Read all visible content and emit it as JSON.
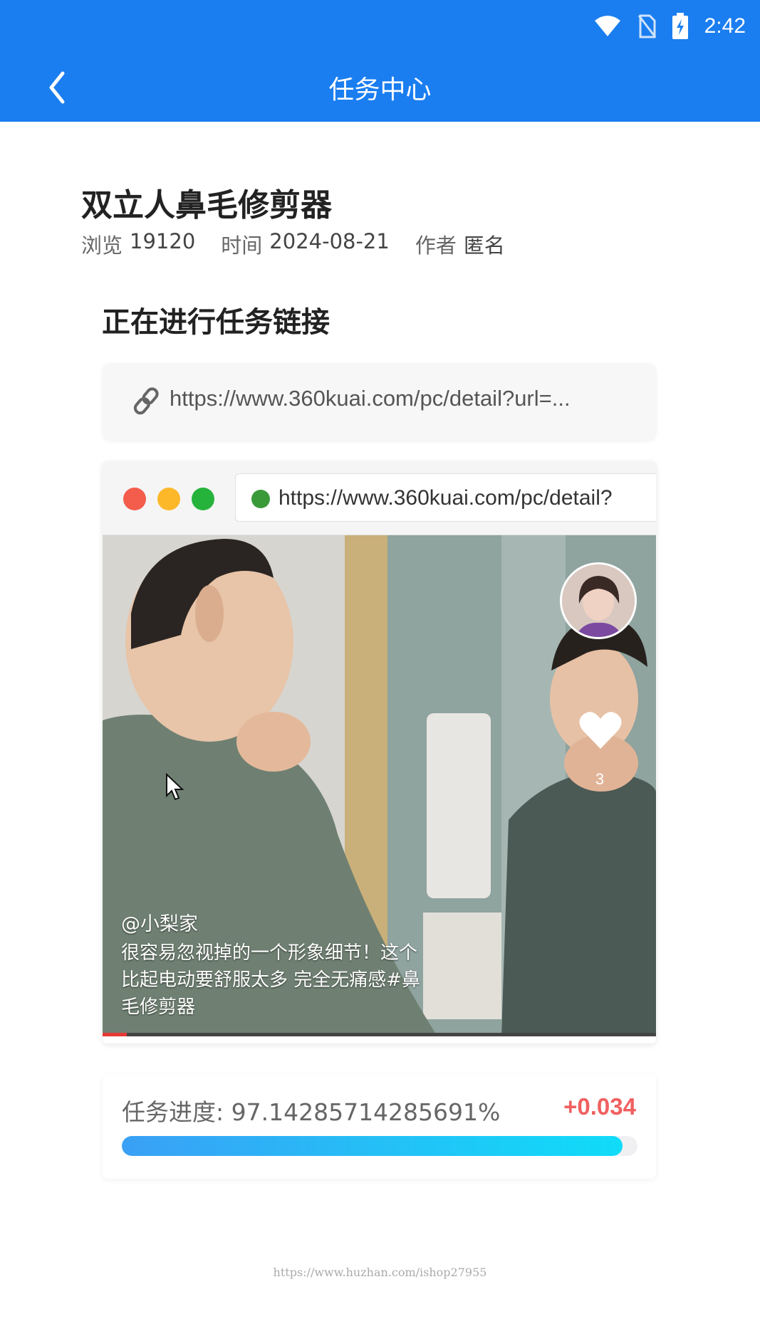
{
  "status_bar": {
    "time": "2:42"
  },
  "header": {
    "title": "任务中心"
  },
  "article": {
    "title": "双立人鼻毛修剪器",
    "views_label": "浏览",
    "views": "19120",
    "time_label": "时间",
    "date": "2024-08-21",
    "author_label": "作者",
    "author": "匿名"
  },
  "task": {
    "section_title": "正在进行任务链接",
    "link": "https://www.360kuai.com/pc/detail?url=...",
    "browser_url": "https://www.360kuai.com/pc/detail?"
  },
  "video": {
    "username": "@小梨家",
    "caption": "很容易忽视掉的一个形象细节！这个比起电动要舒服太多 完全无痛感#鼻毛修剪器",
    "like_count": "3"
  },
  "progress": {
    "label": "任务进度: 97.14285714285691%",
    "percent": 97.14285714285691,
    "delta": "+0.034"
  },
  "watermark": "https://www.huzhan.com/ishop27955",
  "colors": {
    "header_bg": "#1a7ef0",
    "delta": "#f06060",
    "progress_start": "#3aa0f5",
    "progress_end": "#10dcf8"
  }
}
